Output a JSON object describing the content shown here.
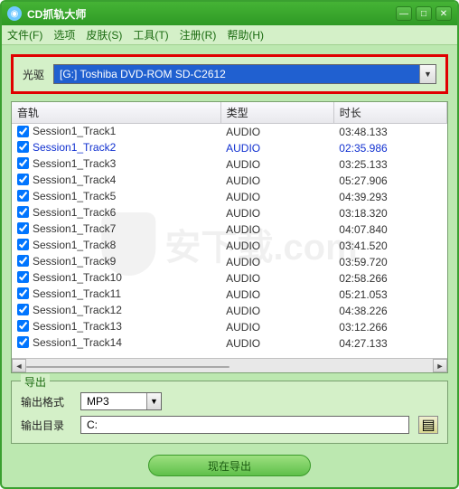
{
  "window": {
    "title": "CD抓轨大师"
  },
  "menu": {
    "file": "文件(F)",
    "options": "选项",
    "skin": "皮肤(S)",
    "tools": "工具(T)",
    "register": "注册(R)",
    "help": "帮助(H)"
  },
  "drive": {
    "label": "光驱",
    "selected": "[G:] Toshiba  DVD-ROM SD-C2612"
  },
  "columns": {
    "name": "音轨",
    "type": "类型",
    "duration": "时长"
  },
  "tracks": [
    {
      "checked": true,
      "name": "Session1_Track1",
      "type": "AUDIO",
      "duration": "03:48.133",
      "selected": false
    },
    {
      "checked": true,
      "name": "Session1_Track2",
      "type": "AUDIO",
      "duration": "02:35.986",
      "selected": true
    },
    {
      "checked": true,
      "name": "Session1_Track3",
      "type": "AUDIO",
      "duration": "03:25.133",
      "selected": false
    },
    {
      "checked": true,
      "name": "Session1_Track4",
      "type": "AUDIO",
      "duration": "05:27.906",
      "selected": false
    },
    {
      "checked": true,
      "name": "Session1_Track5",
      "type": "AUDIO",
      "duration": "04:39.293",
      "selected": false
    },
    {
      "checked": true,
      "name": "Session1_Track6",
      "type": "AUDIO",
      "duration": "03:18.320",
      "selected": false
    },
    {
      "checked": true,
      "name": "Session1_Track7",
      "type": "AUDIO",
      "duration": "04:07.840",
      "selected": false
    },
    {
      "checked": true,
      "name": "Session1_Track8",
      "type": "AUDIO",
      "duration": "03:41.520",
      "selected": false
    },
    {
      "checked": true,
      "name": "Session1_Track9",
      "type": "AUDIO",
      "duration": "03:59.720",
      "selected": false
    },
    {
      "checked": true,
      "name": "Session1_Track10",
      "type": "AUDIO",
      "duration": "02:58.266",
      "selected": false
    },
    {
      "checked": true,
      "name": "Session1_Track11",
      "type": "AUDIO",
      "duration": "05:21.053",
      "selected": false
    },
    {
      "checked": true,
      "name": "Session1_Track12",
      "type": "AUDIO",
      "duration": "04:38.226",
      "selected": false
    },
    {
      "checked": true,
      "name": "Session1_Track13",
      "type": "AUDIO",
      "duration": "03:12.266",
      "selected": false
    },
    {
      "checked": true,
      "name": "Session1_Track14",
      "type": "AUDIO",
      "duration": "04:27.133",
      "selected": false
    }
  ],
  "export": {
    "group_label": "导出",
    "format_label": "输出格式",
    "format_value": "MP3",
    "dir_label": "输出目录",
    "dir_value": "C:",
    "button": "现在导出"
  },
  "watermark": "安下载.com"
}
